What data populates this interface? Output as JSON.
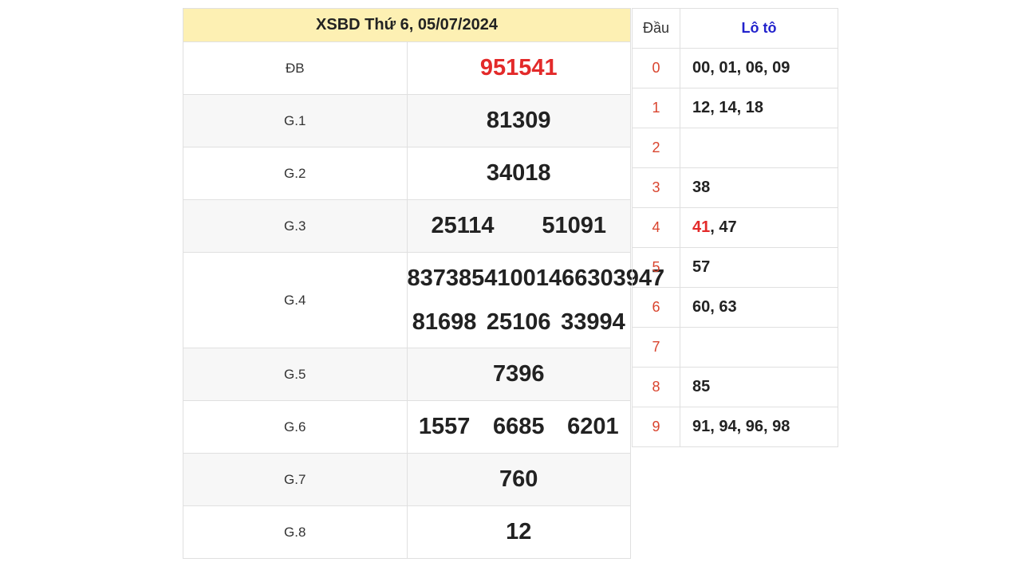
{
  "results": {
    "title": "XSBD Thứ 6, 05/07/2024",
    "prizes": [
      {
        "label": "ĐB",
        "numbers": [
          "951541"
        ]
      },
      {
        "label": "G.1",
        "numbers": [
          "81309"
        ]
      },
      {
        "label": "G.2",
        "numbers": [
          "34018"
        ]
      },
      {
        "label": "G.3",
        "numbers": [
          "25114",
          "51091"
        ]
      },
      {
        "label": "G.4",
        "numbers": [
          "83738",
          "54100",
          "14663",
          "03947",
          "81698",
          "25106",
          "33994"
        ]
      },
      {
        "label": "G.5",
        "numbers": [
          "7396"
        ]
      },
      {
        "label": "G.6",
        "numbers": [
          "1557",
          "6685",
          "6201"
        ]
      },
      {
        "label": "G.7",
        "numbers": [
          "760"
        ]
      },
      {
        "label": "G.8",
        "numbers": [
          "12"
        ]
      }
    ]
  },
  "loto": {
    "header_dau": "Đầu",
    "header_loto": "Lô tô",
    "rows": [
      {
        "dau": "0",
        "values": [
          "00",
          "01",
          "06",
          "09"
        ]
      },
      {
        "dau": "1",
        "values": [
          "12",
          "14",
          "18"
        ]
      },
      {
        "dau": "2",
        "values": []
      },
      {
        "dau": "3",
        "values": [
          "38"
        ]
      },
      {
        "dau": "4",
        "values": [
          "41",
          "47"
        ],
        "highlight": "41"
      },
      {
        "dau": "5",
        "values": [
          "57"
        ]
      },
      {
        "dau": "6",
        "values": [
          "60",
          "63"
        ]
      },
      {
        "dau": "7",
        "values": []
      },
      {
        "dau": "8",
        "values": [
          "85"
        ]
      },
      {
        "dau": "9",
        "values": [
          "91",
          "94",
          "96",
          "98"
        ]
      }
    ]
  },
  "colors": {
    "special": "#e32a2a",
    "title_bg": "#fdf0b3",
    "loto_header": "#2222cc",
    "dau": "#d9442e"
  }
}
